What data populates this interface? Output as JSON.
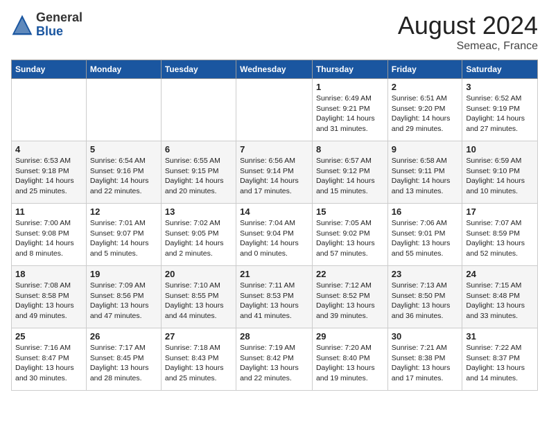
{
  "header": {
    "logo_general": "General",
    "logo_blue": "Blue",
    "month_year": "August 2024",
    "location": "Semeac, France"
  },
  "days_of_week": [
    "Sunday",
    "Monday",
    "Tuesday",
    "Wednesday",
    "Thursday",
    "Friday",
    "Saturday"
  ],
  "weeks": [
    [
      {
        "day": "",
        "info": ""
      },
      {
        "day": "",
        "info": ""
      },
      {
        "day": "",
        "info": ""
      },
      {
        "day": "",
        "info": ""
      },
      {
        "day": "1",
        "info": "Sunrise: 6:49 AM\nSunset: 9:21 PM\nDaylight: 14 hours\nand 31 minutes."
      },
      {
        "day": "2",
        "info": "Sunrise: 6:51 AM\nSunset: 9:20 PM\nDaylight: 14 hours\nand 29 minutes."
      },
      {
        "day": "3",
        "info": "Sunrise: 6:52 AM\nSunset: 9:19 PM\nDaylight: 14 hours\nand 27 minutes."
      }
    ],
    [
      {
        "day": "4",
        "info": "Sunrise: 6:53 AM\nSunset: 9:18 PM\nDaylight: 14 hours\nand 25 minutes."
      },
      {
        "day": "5",
        "info": "Sunrise: 6:54 AM\nSunset: 9:16 PM\nDaylight: 14 hours\nand 22 minutes."
      },
      {
        "day": "6",
        "info": "Sunrise: 6:55 AM\nSunset: 9:15 PM\nDaylight: 14 hours\nand 20 minutes."
      },
      {
        "day": "7",
        "info": "Sunrise: 6:56 AM\nSunset: 9:14 PM\nDaylight: 14 hours\nand 17 minutes."
      },
      {
        "day": "8",
        "info": "Sunrise: 6:57 AM\nSunset: 9:12 PM\nDaylight: 14 hours\nand 15 minutes."
      },
      {
        "day": "9",
        "info": "Sunrise: 6:58 AM\nSunset: 9:11 PM\nDaylight: 14 hours\nand 13 minutes."
      },
      {
        "day": "10",
        "info": "Sunrise: 6:59 AM\nSunset: 9:10 PM\nDaylight: 14 hours\nand 10 minutes."
      }
    ],
    [
      {
        "day": "11",
        "info": "Sunrise: 7:00 AM\nSunset: 9:08 PM\nDaylight: 14 hours\nand 8 minutes."
      },
      {
        "day": "12",
        "info": "Sunrise: 7:01 AM\nSunset: 9:07 PM\nDaylight: 14 hours\nand 5 minutes."
      },
      {
        "day": "13",
        "info": "Sunrise: 7:02 AM\nSunset: 9:05 PM\nDaylight: 14 hours\nand 2 minutes."
      },
      {
        "day": "14",
        "info": "Sunrise: 7:04 AM\nSunset: 9:04 PM\nDaylight: 14 hours\nand 0 minutes."
      },
      {
        "day": "15",
        "info": "Sunrise: 7:05 AM\nSunset: 9:02 PM\nDaylight: 13 hours\nand 57 minutes."
      },
      {
        "day": "16",
        "info": "Sunrise: 7:06 AM\nSunset: 9:01 PM\nDaylight: 13 hours\nand 55 minutes."
      },
      {
        "day": "17",
        "info": "Sunrise: 7:07 AM\nSunset: 8:59 PM\nDaylight: 13 hours\nand 52 minutes."
      }
    ],
    [
      {
        "day": "18",
        "info": "Sunrise: 7:08 AM\nSunset: 8:58 PM\nDaylight: 13 hours\nand 49 minutes."
      },
      {
        "day": "19",
        "info": "Sunrise: 7:09 AM\nSunset: 8:56 PM\nDaylight: 13 hours\nand 47 minutes."
      },
      {
        "day": "20",
        "info": "Sunrise: 7:10 AM\nSunset: 8:55 PM\nDaylight: 13 hours\nand 44 minutes."
      },
      {
        "day": "21",
        "info": "Sunrise: 7:11 AM\nSunset: 8:53 PM\nDaylight: 13 hours\nand 41 minutes."
      },
      {
        "day": "22",
        "info": "Sunrise: 7:12 AM\nSunset: 8:52 PM\nDaylight: 13 hours\nand 39 minutes."
      },
      {
        "day": "23",
        "info": "Sunrise: 7:13 AM\nSunset: 8:50 PM\nDaylight: 13 hours\nand 36 minutes."
      },
      {
        "day": "24",
        "info": "Sunrise: 7:15 AM\nSunset: 8:48 PM\nDaylight: 13 hours\nand 33 minutes."
      }
    ],
    [
      {
        "day": "25",
        "info": "Sunrise: 7:16 AM\nSunset: 8:47 PM\nDaylight: 13 hours\nand 30 minutes."
      },
      {
        "day": "26",
        "info": "Sunrise: 7:17 AM\nSunset: 8:45 PM\nDaylight: 13 hours\nand 28 minutes."
      },
      {
        "day": "27",
        "info": "Sunrise: 7:18 AM\nSunset: 8:43 PM\nDaylight: 13 hours\nand 25 minutes."
      },
      {
        "day": "28",
        "info": "Sunrise: 7:19 AM\nSunset: 8:42 PM\nDaylight: 13 hours\nand 22 minutes."
      },
      {
        "day": "29",
        "info": "Sunrise: 7:20 AM\nSunset: 8:40 PM\nDaylight: 13 hours\nand 19 minutes."
      },
      {
        "day": "30",
        "info": "Sunrise: 7:21 AM\nSunset: 8:38 PM\nDaylight: 13 hours\nand 17 minutes."
      },
      {
        "day": "31",
        "info": "Sunrise: 7:22 AM\nSunset: 8:37 PM\nDaylight: 13 hours\nand 14 minutes."
      }
    ]
  ]
}
